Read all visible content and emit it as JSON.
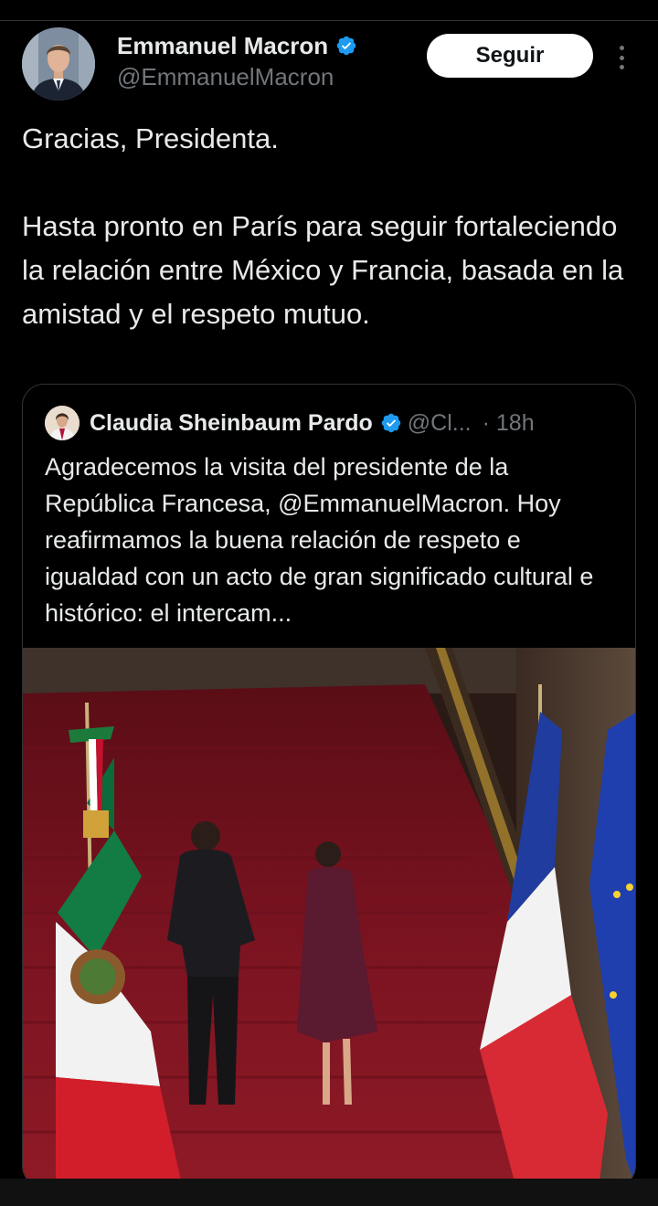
{
  "author": {
    "display_name": "Emmanuel Macron",
    "handle": "@EmmanuelMacron",
    "verified": true,
    "avatar_icon": "avatar-photo"
  },
  "actions": {
    "follow_label": "Seguir",
    "more_icon": "more-vertical-icon"
  },
  "tweet": {
    "text": "Gracias, Presidenta.\n\nHasta pronto en París para seguir fortaleciendo la relación entre México y Francia, basada en la amistad y el respeto mutuo."
  },
  "quoted": {
    "display_name": "Claudia Sheinbaum Pardo",
    "handle": "@Cl...",
    "time": "· 18h",
    "verified": true,
    "text": "Agradecemos la visita del presidente de la República Francesa, @EmmanuelMacron. Hoy reafirmamos la buena relación de respeto e igualdad con un acto de gran significado cultural e histórico: el intercam...",
    "media_icon": "photo-staircase-flags"
  },
  "colors": {
    "background": "#000000",
    "text": "#e7e9ea",
    "secondary": "#71767b",
    "verified": "#1d9bf0",
    "border": "#2f3336"
  }
}
